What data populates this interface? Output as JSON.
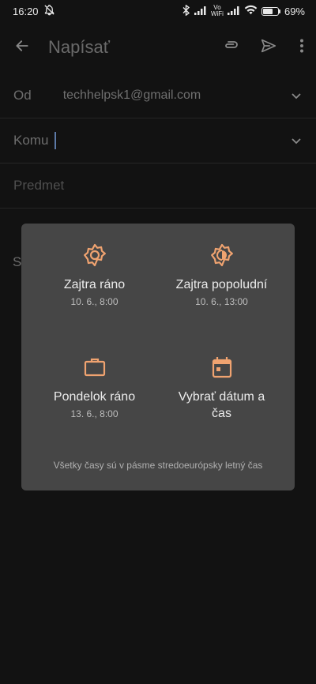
{
  "status": {
    "time": "16:20",
    "vowifi_top": "Vo",
    "vowifi_bottom": "WiFi",
    "battery": "69%",
    "battery_level": 0.69
  },
  "appbar": {
    "title": "Napísať"
  },
  "fields": {
    "from_label": "Od",
    "from_value": "techhelpsk1@gmail.com",
    "to_label": "Komu",
    "subject_placeholder": "Predmet",
    "body_peek": "S"
  },
  "schedule": {
    "options": [
      {
        "title": "Zajtra ráno",
        "subtitle": "10. 6., 8:00",
        "icon": "sun-icon"
      },
      {
        "title": "Zajtra popoludní",
        "subtitle": "10. 6., 13:00",
        "icon": "half-sun-icon"
      },
      {
        "title": "Pondelok ráno",
        "subtitle": "13. 6., 8:00",
        "icon": "briefcase-icon"
      },
      {
        "title": "Vybrať dátum a čas",
        "subtitle": "",
        "icon": "calendar-icon"
      }
    ],
    "timezone_note": "Všetky časy sú v pásme stredoeurópsky letný čas"
  },
  "colors": {
    "accent": "#f0a370",
    "dialog_bg": "#464646",
    "background": "#121212"
  }
}
